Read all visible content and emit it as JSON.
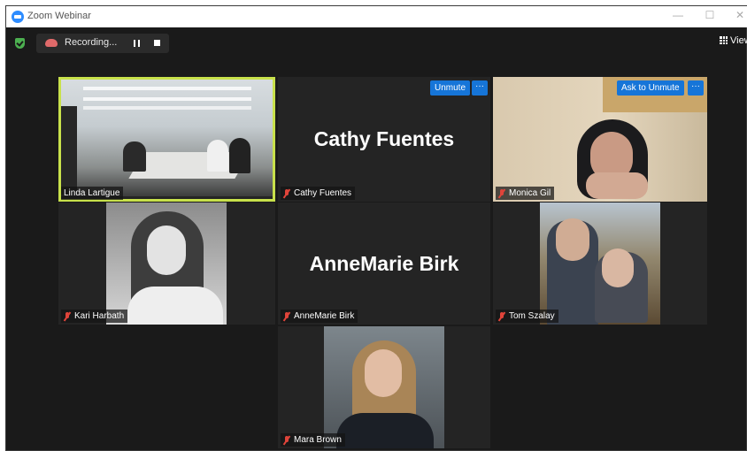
{
  "window": {
    "title": "Zoom Webinar",
    "minimize": "—",
    "maximize": "☐",
    "close": "✕"
  },
  "topbar": {
    "recording_label": "Recording...",
    "view_label": "View"
  },
  "participants": [
    {
      "name": "Linda Lartigue"
    },
    {
      "name": "Cathy Fuentes",
      "display_name": "Cathy Fuentes",
      "button": "Unmute",
      "more": "···"
    },
    {
      "name": "Monica Gil",
      "button": "Ask to Unmute",
      "more": "···"
    },
    {
      "name": "Kari Harbath"
    },
    {
      "name": "AnneMarie Birk",
      "display_name": "AnneMarie Birk"
    },
    {
      "name": "Tom Szalay"
    },
    {
      "name": "Mara Brown"
    }
  ],
  "colors": {
    "active_speaker_border": "#c8e14b",
    "button_blue": "#1675d8",
    "muted_red": "#e0443a"
  },
  "icons": [
    "zoom-app-icon",
    "security-shield-icon",
    "cloud-recording-icon",
    "pause-icon",
    "stop-icon",
    "grid-view-icon",
    "mic-muted-icon"
  ]
}
